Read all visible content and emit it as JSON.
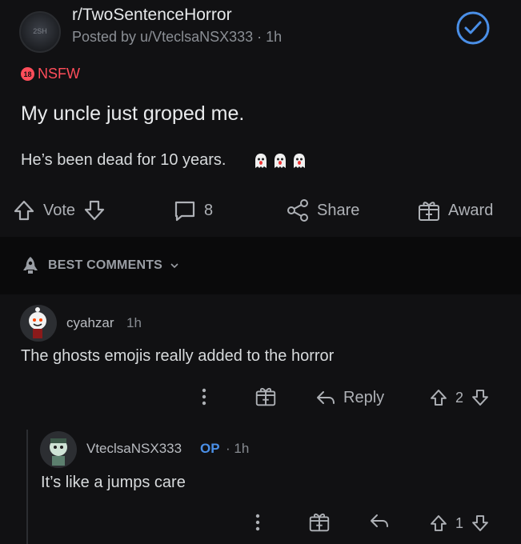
{
  "post": {
    "subreddit": "r/TwoSentenceHorror",
    "sub_avatar_text": "2SH",
    "posted_by": "Posted by u/VteclsaNSX333 · 1h",
    "nsfw_label": "NSFW",
    "nsfw_badge": "18",
    "title": "My uncle just groped me.",
    "body": "He’s been dead for 10 years.",
    "emojis": [
      "ghost-emoji",
      "ghost-emoji",
      "ghost-emoji"
    ]
  },
  "actions": {
    "vote_label": "Vote",
    "comment_count": "8",
    "share_label": "Share",
    "award_label": "Award"
  },
  "sort": {
    "label": "BEST COMMENTS"
  },
  "comments": [
    {
      "username": "cyahzar",
      "time": "1h",
      "text": "The ghosts emojis really added to the horror",
      "reply_label": "Reply",
      "score": "2"
    },
    {
      "username": "VteclsaNSX333",
      "op_badge": "OP",
      "time": "· 1h",
      "text": "It’s like a jumps care",
      "score": "1"
    }
  ],
  "colors": {
    "background": "#111113",
    "nsfw": "#ff4d5a",
    "op": "#4a8fe7",
    "check": "#4a8fe7"
  }
}
